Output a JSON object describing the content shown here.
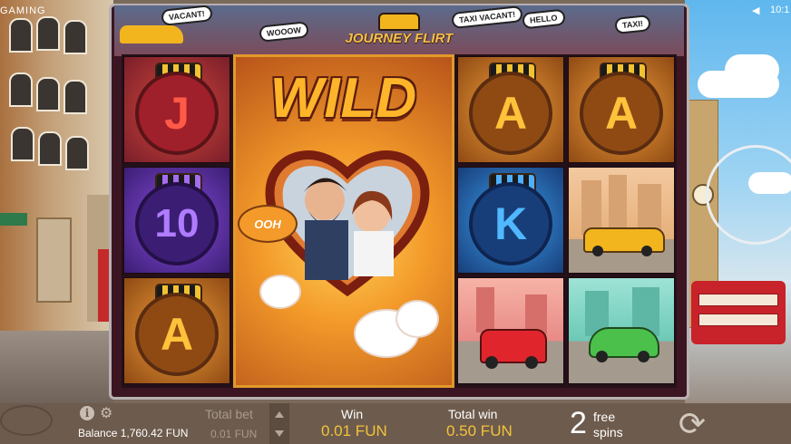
{
  "brand": "GAMING",
  "clock": "10:1",
  "game": {
    "logo_title": "JOURNEY FLIRT",
    "header_bubbles": [
      "VACANT!",
      "WOOOW",
      "TAXI VACANT!",
      "HELLO",
      "TAXI!"
    ],
    "wild_label": "WILD",
    "wild_ooh": "OOH",
    "reels": [
      [
        {
          "symbol": "J",
          "color": "#e8473c",
          "ring": "#9f1f2a"
        },
        {
          "symbol": "10",
          "color": "#8a4ce0",
          "ring": "#3b1e73"
        },
        {
          "symbol": "A",
          "color": "#f2b93a",
          "ring": "#8f4a14"
        }
      ],
      [
        {
          "symbol": "WILD"
        }
      ],
      [
        {
          "symbol": "A",
          "color": "#f2b93a",
          "ring": "#8f4a14"
        },
        {
          "symbol": "K",
          "color": "#3ba1f0",
          "ring": "#183e7a"
        },
        {
          "symbol": "tuk-tuk"
        }
      ],
      [
        {
          "symbol": "A",
          "color": "#f2b93a",
          "ring": "#8f4a14"
        },
        {
          "symbol": "yellow-taxi"
        },
        {
          "symbol": "green-beetle"
        }
      ]
    ]
  },
  "bottom_bar": {
    "balance_label": "Balance",
    "balance_value": "1,760.42 FUN",
    "total_bet_label": "Total bet",
    "total_bet_value": "0.01 FUN",
    "win_label": "Win",
    "win_value": "0.01 FUN",
    "total_win_label": "Total win",
    "total_win_value": "0.50 FUN",
    "free_spins_count": "2",
    "free_spins_label_1": "free",
    "free_spins_label_2": "spins"
  }
}
